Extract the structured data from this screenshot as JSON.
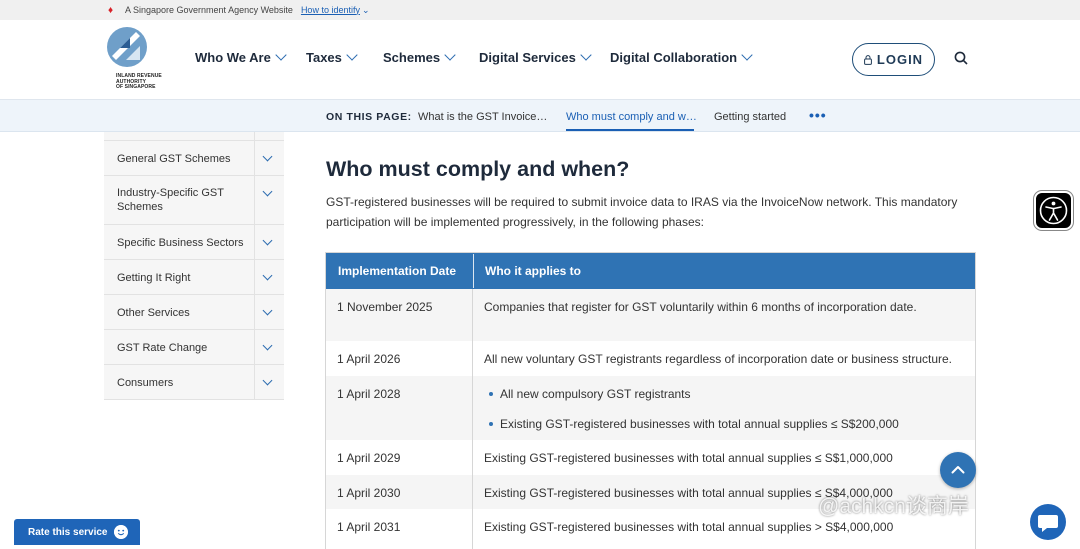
{
  "gov_banner": {
    "text": "A Singapore Government Agency Website",
    "identify_link": "How to identify"
  },
  "header": {
    "logo_text": [
      "INLAND REVENUE",
      "AUTHORITY",
      "OF SINGAPORE"
    ],
    "nav": [
      "Who We Are",
      "Taxes",
      "Schemes",
      "Digital Services",
      "Digital Collaboration"
    ],
    "login_label": "LOGIN"
  },
  "on_this_page": {
    "label": "ON THIS PAGE:",
    "links": [
      "What is the GST Invoice…",
      "Who must comply and w…",
      "Getting started"
    ],
    "active_index": 1,
    "more": "•••"
  },
  "sidebar": {
    "items": [
      "General GST Schemes",
      "Industry-Specific GST Schemes",
      "Specific Business Sectors",
      "Getting It Right",
      "Other Services",
      "GST Rate Change",
      "Consumers"
    ]
  },
  "main": {
    "title": "Who must comply and when?",
    "intro": "GST-registered businesses will be required to submit invoice data to IRAS via the InvoiceNow network. This mandatory participation will be implemented progressively, in the following phases:",
    "table": {
      "headers": [
        "Implementation Date",
        "Who it applies to"
      ],
      "rows": [
        {
          "date": "1 November 2025",
          "applies": "Companies that register for GST voluntarily within 6 months of incorporation date."
        },
        {
          "date": "1 April 2026",
          "applies": "All new voluntary GST registrants regardless of incorporation date or business structure."
        },
        {
          "date": "1 April 2028",
          "bullets": [
            "All new compulsory GST registrants",
            "Existing GST-registered businesses with total annual supplies ≤ S$200,000"
          ]
        },
        {
          "date": "1 April 2029",
          "applies": "Existing GST-registered businesses with total annual supplies ≤ S$1,000,000"
        },
        {
          "date": "1 April 2030",
          "applies": "Existing GST-registered businesses with total annual supplies ≤ S$4,000,000"
        },
        {
          "date": "1 April 2031",
          "applies": "Existing GST-registered businesses with total annual supplies > S$4,000,000"
        }
      ]
    }
  },
  "floating": {
    "rate_label": "Rate this service",
    "watermark": "@achkcn谈商岸"
  },
  "colors": {
    "primary": "#2f73b4",
    "dark_text": "#1e2a3b",
    "link": "#1a5fb4"
  }
}
